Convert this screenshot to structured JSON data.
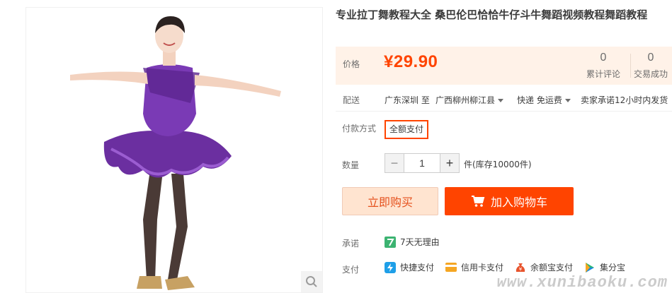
{
  "product": {
    "title": "专业拉丁舞教程大全 桑巴伦巴恰恰牛仔斗牛舞蹈视频教程舞蹈教程"
  },
  "price": {
    "label": "价格",
    "value": "¥29.90"
  },
  "stats": [
    {
      "number": "0",
      "label": "累计评论"
    },
    {
      "number": "0",
      "label": "交易成功"
    }
  ],
  "shipping": {
    "label": "配送",
    "origin": "广东深圳 至",
    "destination": "广西柳州柳江县",
    "method": "快递 免运费",
    "promise": "卖家承诺12小时内发货"
  },
  "payment_type": {
    "label": "付款方式",
    "option": "全额支付"
  },
  "quantity": {
    "label": "数量",
    "minus": "−",
    "value": "1",
    "plus": "+",
    "stock": "件(库存10000件)"
  },
  "buttons": {
    "buy_now": "立即购买",
    "add_to_cart": "加入购物车"
  },
  "promise": {
    "label": "承诺",
    "item": "7天无理由"
  },
  "payment": {
    "label": "支付",
    "methods": [
      "快捷支付",
      "信用卡支付",
      "余额宝支付",
      "集分宝"
    ]
  },
  "watermark": "www.xunibaoku.com",
  "colors": {
    "accent": "#ff4400",
    "price_bg": "#fff2e8",
    "buy_bg": "#ffe4d0"
  }
}
